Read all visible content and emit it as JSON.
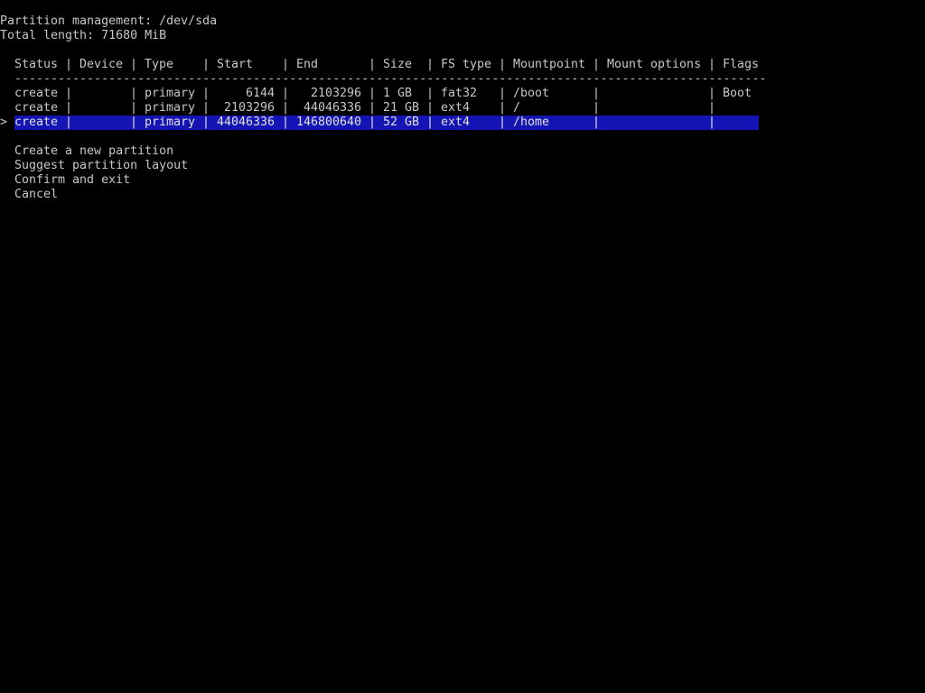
{
  "header": {
    "title": "Partition management: /dev/sda",
    "total_length": "Total length: 71680 MiB"
  },
  "table": {
    "columns": {
      "status": "Status",
      "device": "Device",
      "type": "Type",
      "start": "Start",
      "end": "End",
      "size": "Size",
      "fs_type": "FS type",
      "mountpoint": "Mountpoint",
      "mount_options": "Mount options",
      "flags": "Flags"
    },
    "separator": "|",
    "divider": "----------------------------------------------------------------------------------------------------------",
    "cursor": ">",
    "selected_index": 2,
    "rows": [
      {
        "status": "create",
        "device": "",
        "type": "primary",
        "start": "6144",
        "end": "2103296",
        "size": "1 GB",
        "fs_type": "fat32",
        "mountpoint": "/boot",
        "mount_options": "",
        "flags": "Boot"
      },
      {
        "status": "create",
        "device": "",
        "type": "primary",
        "start": "2103296",
        "end": "44046336",
        "size": "21 GB",
        "fs_type": "ext4",
        "mountpoint": "/",
        "mount_options": "",
        "flags": ""
      },
      {
        "status": "create",
        "device": "",
        "type": "primary",
        "start": "44046336",
        "end": "146800640",
        "size": "52 GB",
        "fs_type": "ext4",
        "mountpoint": "/home",
        "mount_options": "",
        "flags": ""
      }
    ]
  },
  "menu": {
    "items": [
      "Create a new partition",
      "Suggest partition layout",
      "Confirm and exit",
      "Cancel"
    ]
  },
  "colors": {
    "background": "#000000",
    "text": "#c6c6c6",
    "selection": "#1414b4"
  }
}
